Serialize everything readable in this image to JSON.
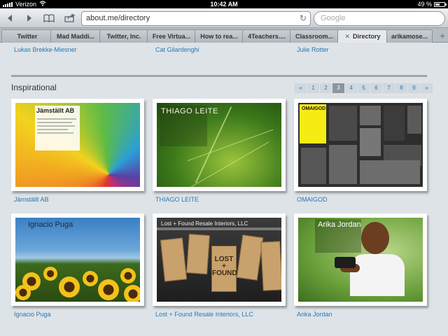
{
  "status_bar": {
    "carrier": "Verizon",
    "time": "10:42 AM",
    "battery_percent": "49 %",
    "battery_level": 0.49
  },
  "toolbar": {
    "url": "about.me/directory",
    "search_placeholder": "Google"
  },
  "tabs": [
    {
      "label": "Twitter",
      "active": false
    },
    {
      "label": "Mad Maddi...",
      "active": false
    },
    {
      "label": "Twitter, Inc.",
      "active": false
    },
    {
      "label": "Free Virtua...",
      "active": false
    },
    {
      "label": "How to rea...",
      "active": false
    },
    {
      "label": "4Teachers....",
      "active": false
    },
    {
      "label": "Classroom...",
      "active": false
    },
    {
      "label": "Directory",
      "active": true
    },
    {
      "label": "arikamose...",
      "active": false
    }
  ],
  "previous_row": [
    "Lukas Brekke-Miesner",
    "Cat Gilardenghi",
    "Julie Rotter"
  ],
  "section": {
    "title": "Inspirational",
    "pagination": {
      "first": "«",
      "last": "»",
      "pages": [
        "1",
        "2",
        "3",
        "4",
        "5",
        "6",
        "7",
        "8",
        "9"
      ],
      "current": "3"
    }
  },
  "profiles": [
    {
      "name": "Jämställt AB",
      "thumb_title": "Jämställt AB"
    },
    {
      "name": "THIAGO LEITE",
      "thumb_title": "THIAGO LEITE"
    },
    {
      "name": "OMAIGOD",
      "thumb_title": "OMAIGOD"
    },
    {
      "name": "Ignacio Puga",
      "thumb_title": "Ignacio Puga"
    },
    {
      "name": "Lost + Found Resale Interiors, LLC",
      "thumb_title": "Lost + Found Resale Interiors, LLC",
      "tag_text": "LOST + FOUND"
    },
    {
      "name": "Arika Jordan",
      "thumb_title": "Arika Jordan"
    }
  ],
  "colors": {
    "link": "#2b78b3",
    "page_background": "#dde3e7",
    "pager_current": "#8c959c"
  }
}
